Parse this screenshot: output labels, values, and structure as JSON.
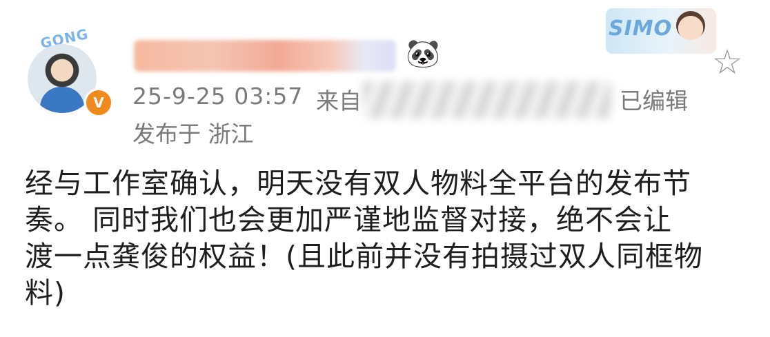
{
  "post": {
    "author": {
      "avatar_frame_text": "GONG",
      "verified_badge": "V"
    },
    "timestamp": "25-9-25 03:57",
    "source_label": "来自",
    "edited_label": "已编辑",
    "location": "发布于 浙江",
    "decoration": {
      "text": "SIMO"
    },
    "body_lines": [
      "经与工作室确认，明天没有双人物料全平台的发布节",
      "奏。 同时我们也会更加严谨地监督对接，绝不会让",
      "渡一点龚俊的权益！(且此前并没有拍摄过双人同框物",
      "料)"
    ]
  },
  "icons": {
    "panda": "panda-icon",
    "favorite": "star-icon"
  },
  "colors": {
    "meta_text": "#7a7a7a",
    "verified_badge": "#f08a1c",
    "body_text": "#1e1e1e"
  }
}
